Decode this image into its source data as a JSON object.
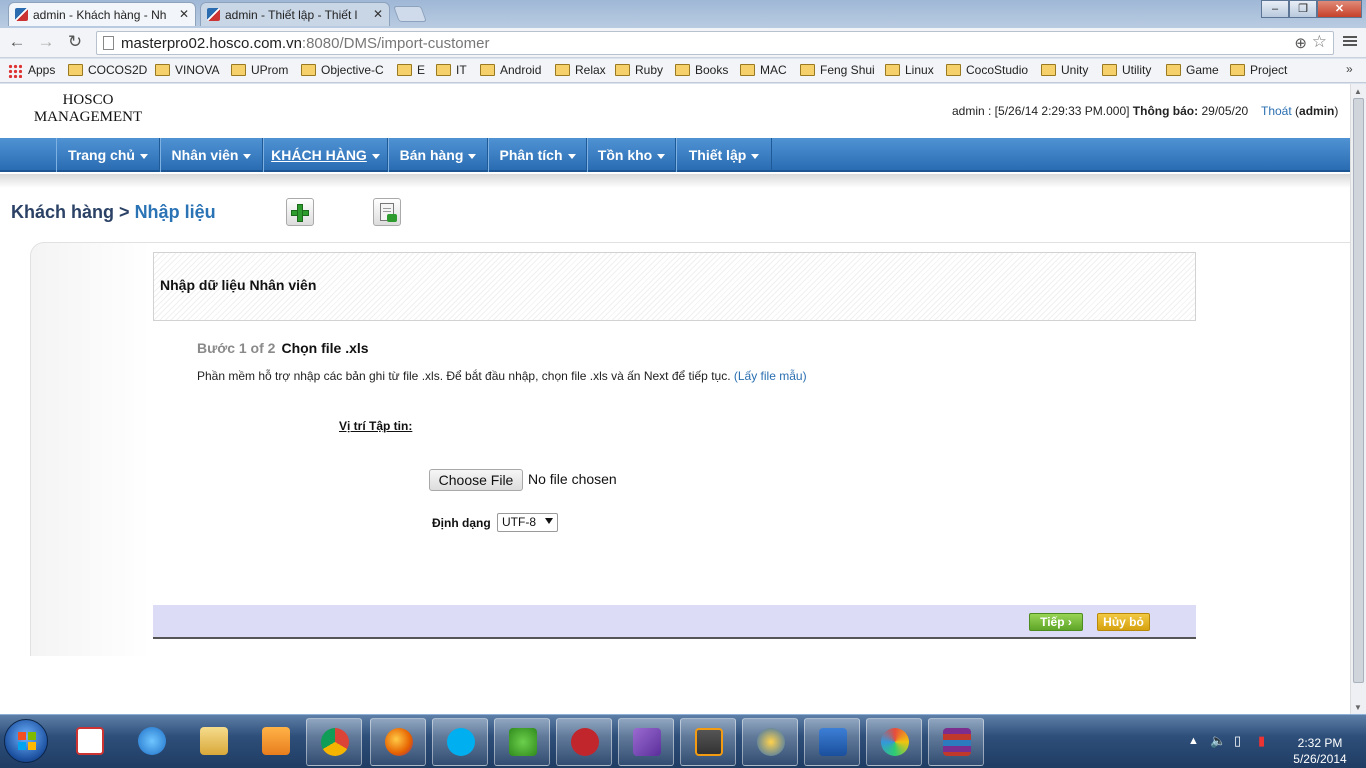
{
  "browser": {
    "tabs": [
      {
        "title": "admin - Khách hàng - Nh",
        "active": true
      },
      {
        "title": "admin - Thiết lập - Thiết l",
        "active": false
      }
    ],
    "url_host": "masterpro02.hosco.com.vn",
    "url_rest": ":8080/DMS/import-customer",
    "bookmarks": [
      "Apps",
      "COCOS2D",
      "VINOVA",
      "UProm",
      "Objective-C",
      "E",
      "IT",
      "Android",
      "Relax",
      "Ruby",
      "Books",
      "MAC",
      "Feng Shui",
      "Linux",
      "CocoStudio",
      "Unity",
      "Utility",
      "Game",
      "Project"
    ],
    "bookmarks_more": "»"
  },
  "header": {
    "logo_line1": "HOSCO",
    "logo_line2": "MANAGEMENT",
    "user_prefix": "admin : [5/26/14 2:29:33 PM.000]",
    "notice_label": "Thông báo:",
    "notice_value": "29/05/20",
    "logout_label": "Thoát",
    "logout_user": "admin"
  },
  "nav": {
    "items": [
      "Trang chủ",
      "Nhân viên",
      "KHÁCH HÀNG",
      "Bán hàng",
      "Phân tích",
      "Tồn kho",
      "Thiết lập"
    ],
    "active_index": 2
  },
  "breadcrumb": {
    "parent": "Khách hàng",
    "separator": ">",
    "current": "Nhập liệu",
    "icons": [
      "add-icon",
      "import-icon"
    ]
  },
  "form": {
    "header": "Nhập dữ liệu Nhân viên",
    "step_label": "Bước 1 of 2",
    "step_title": "Chọn file .xls",
    "description": "Phần mềm hỗ trợ nhập các bản ghi từ file .xls. Để bắt đầu nhập, chọn file .xls và ấn Next để tiếp tục.",
    "sample_link": "(Lấy file mẫu)",
    "file_location_label": "Vị trí Tập tin:",
    "choose_file_label": "Choose File",
    "no_file_text": "No file chosen",
    "format_label": "Định dạng",
    "format_value": "UTF-8",
    "next_label": "Tiếp ›",
    "cancel_label": "Hủy bỏ"
  },
  "taskbar": {
    "apps": [
      "unikey",
      "internet-explorer",
      "file-explorer",
      "media-player",
      "chrome",
      "firefox",
      "skype",
      "clover",
      "app-red",
      "visual-studio",
      "sublime-text",
      "app-penguin",
      "word",
      "paint",
      "winrar"
    ],
    "time": "2:32 PM",
    "date": "5/26/2014"
  },
  "colors": {
    "nav_blue": "#2a6cb2",
    "link_blue": "#2a6fb1",
    "next_green": "#5fa628",
    "cancel_yellow": "#d6a20f",
    "footer_lavender": "#dcdcf6"
  }
}
